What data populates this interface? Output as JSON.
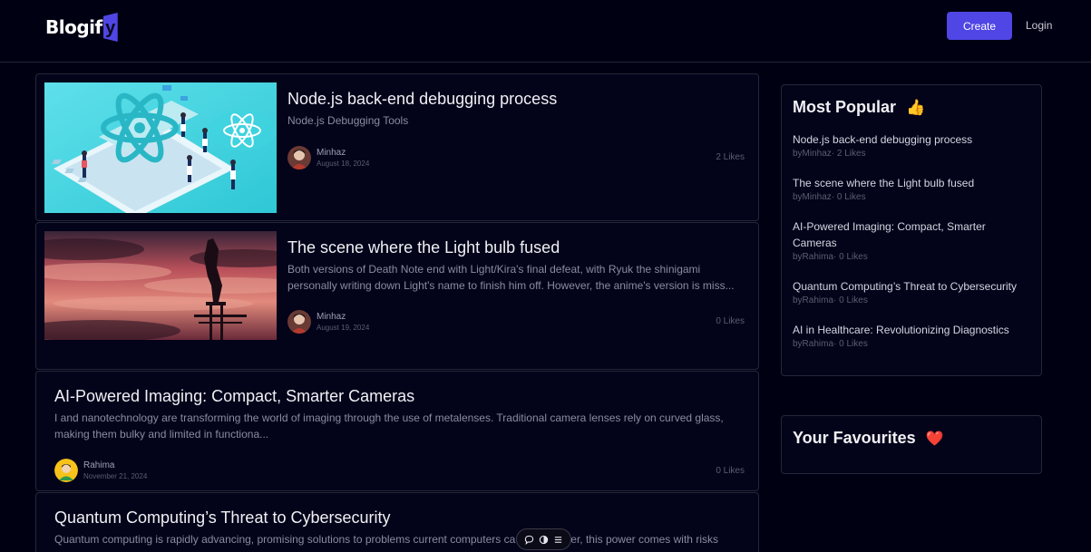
{
  "header": {
    "logo_text": "Blogif",
    "logo_mark": "y",
    "create_label": "Create",
    "login_label": "Login"
  },
  "posts": [
    {
      "title": "Node.js back-end debugging process",
      "subtitle": "Node.js Debugging Tools",
      "author": "Minhaz",
      "date": "August 18, 2024",
      "likes": "2 Likes",
      "thumbnail": "react-isometric-illustration"
    },
    {
      "title": "The scene where the Light bulb fused",
      "subtitle": "Both versions of Death Note end with Light/Kira's final defeat, with Ryuk the shinigami personally writing down Light's name to finish him off. However, the anime's version is miss...",
      "author": "Minhaz",
      "date": "August 19, 2024",
      "likes": "0 Likes",
      "thumbnail": "anime-sunset-scene"
    },
    {
      "title": "AI-Powered Imaging: Compact, Smarter Cameras",
      "subtitle": "I and nanotechnology are transforming the world of imaging through the use of metalenses. Traditional camera lenses rely on curved glass, making them bulky and limited in functiona...",
      "author": "Rahima",
      "date": "November 21, 2024",
      "likes": "0 Likes"
    },
    {
      "title": "Quantum Computing’s Threat to Cybersecurity",
      "subtitle": "Quantum computing is rapidly advancing, promising solutions to problems current computers ca",
      "subtitle_tail": "owever, this power comes with risks"
    }
  ],
  "sidebar": {
    "popular_title": "Most Popular",
    "popular_emoji": "👍",
    "popular": [
      {
        "title": "Node.js back-end debugging process",
        "meta": "byMinhaz· 2 Likes"
      },
      {
        "title": "The scene where the Light bulb fused",
        "meta": "byMinhaz· 0 Likes"
      },
      {
        "title": "AI-Powered Imaging: Compact, Smarter Cameras",
        "meta": "byRahima· 0 Likes"
      },
      {
        "title": "Quantum Computing’s Threat to Cybersecurity",
        "meta": "byRahima· 0 Likes"
      },
      {
        "title": "AI in Healthcare: Revolutionizing Diagnostics",
        "meta": "byRahima· 0 Likes"
      }
    ],
    "favourites_title": "Your Favourites",
    "favourites_emoji": "❤️"
  },
  "floatbar": {
    "icons": [
      "chat-bubble-icon",
      "toggle-icon",
      "menu-icon"
    ]
  },
  "colors": {
    "background": "#000013",
    "accent": "#4f46e5",
    "card_border": "#25273a"
  }
}
